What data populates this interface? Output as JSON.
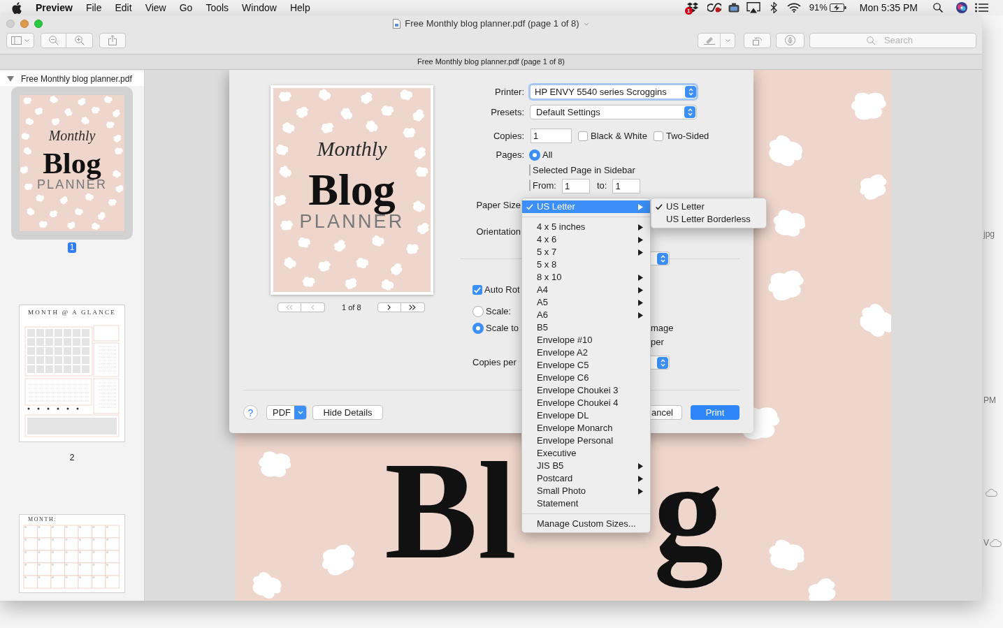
{
  "menu_bar": {
    "app_name": "Preview",
    "menus": [
      "File",
      "Edit",
      "View",
      "Go",
      "Tools",
      "Window",
      "Help"
    ],
    "notification_count": "1",
    "battery": "91%",
    "clock": "Mon 5:35 PM"
  },
  "window": {
    "controls": [
      {
        "kind": "close",
        "disabled": true
      },
      {
        "kind": "minimize",
        "disabled": false
      },
      {
        "kind": "zoom",
        "disabled": false
      }
    ],
    "title": "Free Monthly blog planner.pdf (page 1 of 8)",
    "search": {
      "placeholder": "Search"
    },
    "path_bar": "Free Monthly blog planner.pdf (page 1 of 8)"
  },
  "sidebar": {
    "document": "Free Monthly blog planner.pdf",
    "expanded": true,
    "thumbnails": [
      {
        "kind": "cover",
        "label": "1",
        "selected": true,
        "script": "Monthly",
        "title": "Blog",
        "subtitle": "PLANNER"
      },
      {
        "kind": "glance",
        "label": "2",
        "selected": false,
        "title": "MONTH @ A GLANCE"
      },
      {
        "kind": "calendar",
        "selected": false,
        "title": "MONTH:"
      }
    ]
  },
  "document_page": {
    "title_fragments": [
      "Bl",
      "g"
    ]
  },
  "print_dialog": {
    "preview": {
      "script": "Monthly",
      "title": "Blog",
      "subtitle": "PLANNER",
      "page_indicator": "1 of 8",
      "nav": [
        {
          "kind": "first",
          "disabled": true
        },
        {
          "kind": "previous",
          "disabled": true
        },
        {
          "kind": "next",
          "disabled": false
        },
        {
          "kind": "last",
          "disabled": false
        }
      ]
    },
    "printer": {
      "label": "Printer:",
      "value": "HP ENVY 5540 series Scroggins",
      "focused": true
    },
    "presets": {
      "label": "Presets:",
      "value": "Default Settings",
      "focused": false
    },
    "copies": {
      "label": "Copies:",
      "value": "1"
    },
    "options": [
      {
        "label": "Black & White",
        "checked": false
      },
      {
        "label": "Two-Sided",
        "checked": false
      }
    ],
    "pages": {
      "label": "Pages:",
      "choices": [
        {
          "kind": "all",
          "label": "All",
          "selected": true
        },
        {
          "kind": "sidebar",
          "label": "Selected Page in Sidebar",
          "selected": false
        },
        {
          "kind": "range",
          "label": "From:",
          "selected": false,
          "from": "1",
          "to_label": "to:",
          "to": "1"
        }
      ]
    },
    "paper_size_label": "Paper Size",
    "orientation_label": "Orientation",
    "auto_rotate": {
      "label": "Auto Rot",
      "checked": true
    },
    "scale_choices": [
      {
        "label": "Scale:",
        "selected": false
      },
      {
        "label": "Scale to",
        "selected": true
      }
    ],
    "fit_fragments": [
      "mage",
      "per"
    ],
    "copies_per_label": "Copies per",
    "buttons": {
      "help": "?",
      "pdf": "PDF",
      "details": "Hide Details",
      "cancel": "ancel",
      "print": "Print"
    }
  },
  "paper_size_menu": {
    "sections": [
      [
        {
          "label": "US Letter",
          "selected": true,
          "checked": true,
          "submenu": true
        }
      ],
      [
        {
          "label": "4 x 5 inches",
          "selected": false,
          "checked": false,
          "submenu": true
        },
        {
          "label": "4 x 6",
          "selected": false,
          "checked": false,
          "submenu": true
        },
        {
          "label": "5 x 7",
          "selected": false,
          "checked": false,
          "submenu": true
        },
        {
          "label": "5 x 8",
          "selected": false,
          "checked": false,
          "submenu": false
        },
        {
          "label": "8 x 10",
          "selected": false,
          "checked": false,
          "submenu": true
        },
        {
          "label": "A4",
          "selected": false,
          "checked": false,
          "submenu": true
        },
        {
          "label": "A5",
          "selected": false,
          "checked": false,
          "submenu": true
        },
        {
          "label": "A6",
          "selected": false,
          "checked": false,
          "submenu": true
        },
        {
          "label": "B5",
          "selected": false,
          "checked": false,
          "submenu": false
        },
        {
          "label": "Envelope #10",
          "selected": false,
          "checked": false,
          "submenu": false
        },
        {
          "label": "Envelope A2",
          "selected": false,
          "checked": false,
          "submenu": false
        },
        {
          "label": "Envelope C5",
          "selected": false,
          "checked": false,
          "submenu": false
        },
        {
          "label": "Envelope C6",
          "selected": false,
          "checked": false,
          "submenu": false
        },
        {
          "label": "Envelope Choukei 3",
          "selected": false,
          "checked": false,
          "submenu": false
        },
        {
          "label": "Envelope Choukei 4",
          "selected": false,
          "checked": false,
          "submenu": false
        },
        {
          "label": "Envelope DL",
          "selected": false,
          "checked": false,
          "submenu": false
        },
        {
          "label": "Envelope Monarch",
          "selected": false,
          "checked": false,
          "submenu": false
        },
        {
          "label": "Envelope Personal",
          "selected": false,
          "checked": false,
          "submenu": false
        },
        {
          "label": "Executive",
          "selected": false,
          "checked": false,
          "submenu": false
        },
        {
          "label": "JIS B5",
          "selected": false,
          "checked": false,
          "submenu": true
        },
        {
          "label": "Postcard",
          "selected": false,
          "checked": false,
          "submenu": true
        },
        {
          "label": "Small Photo",
          "selected": false,
          "checked": false,
          "submenu": true
        },
        {
          "label": "Statement",
          "selected": false,
          "checked": false,
          "submenu": false
        }
      ],
      [
        {
          "label": "Manage Custom Sizes...",
          "selected": false,
          "checked": false,
          "submenu": false
        }
      ]
    ]
  },
  "paper_size_submenu": {
    "items": [
      {
        "label": "US Letter",
        "selected": false,
        "checked": true,
        "submenu": false
      },
      {
        "label": "US Letter Borderless",
        "selected": false,
        "checked": false,
        "submenu": false
      }
    ]
  },
  "desktop_labels": [
    "jpg",
    "PM",
    "V"
  ]
}
